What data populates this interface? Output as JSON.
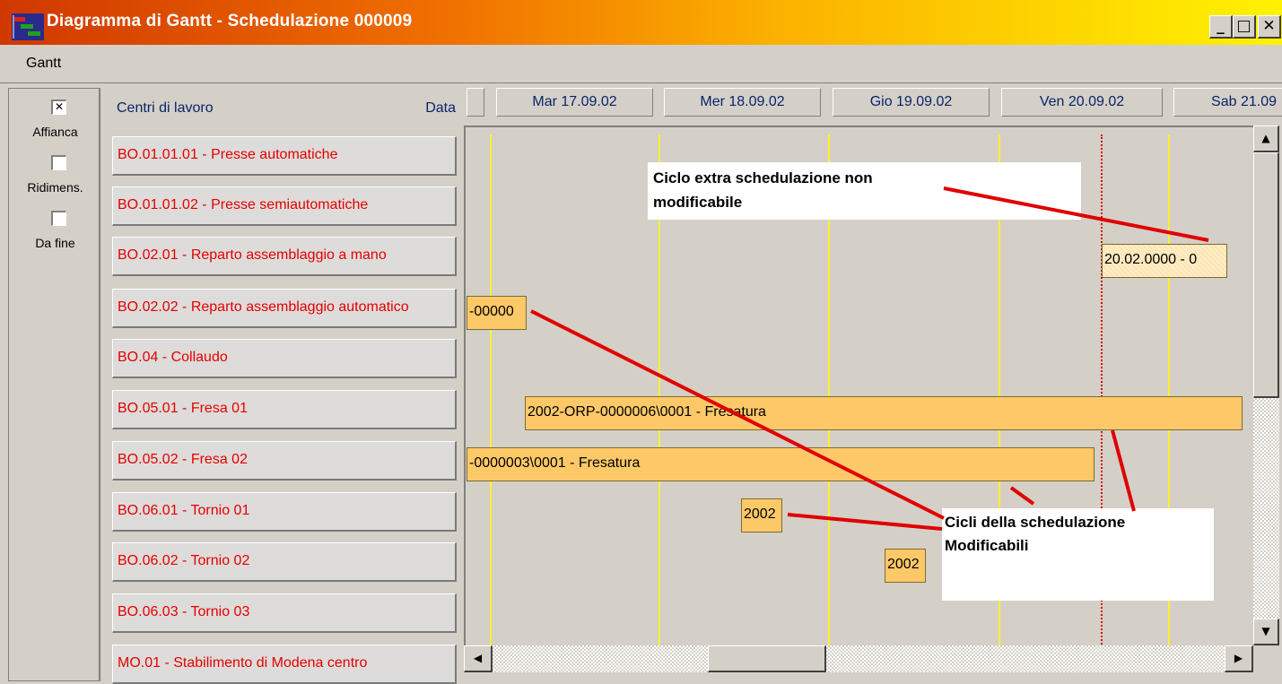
{
  "window": {
    "title": "Diagramma di Gantt  -  Schedulazione 000009",
    "controls": {
      "minimize": "_",
      "maximize": "□",
      "close": "✕"
    }
  },
  "menu": {
    "gantt": "Gantt"
  },
  "options": [
    {
      "label": "Affianca",
      "checked": true
    },
    {
      "label": "Ridimens.",
      "checked": false
    },
    {
      "label": "Da fine",
      "checked": false
    }
  ],
  "header": {
    "centri": "Centri di lavoro",
    "data": "Data"
  },
  "dates": [
    "Mar 17.09.02",
    "Mer 18.09.02",
    "Gio 19.09.02",
    "Ven 20.09.02",
    "Sab 21.09"
  ],
  "work_centers": [
    "BO.01.01.01 - Presse automatiche",
    "BO.01.01.02 - Presse semiautomatiche",
    "BO.02.01 - Reparto assemblaggio a mano",
    "BO.02.02 - Reparto assemblaggio automatico",
    "BO.04 - Collaudo",
    "BO.05.01 - Fresa 01",
    "BO.05.02 - Fresa 02",
    "BO.06.01 - Tornio 01",
    "BO.06.02 - Tornio 02",
    "BO.06.03 - Tornio 03",
    "MO.01 - Stabilimento di Modena centro"
  ],
  "bars": {
    "b1": "20.02.0000 - 0",
    "b2": "-00000",
    "b3": "2002-ORP-0000006\\0001 - Fresatura",
    "b4": "-0000003\\0001 - Fresatura",
    "b5": "2002",
    "b6": "2002"
  },
  "callouts": {
    "extra": "Ciclo extra schedulazione non modificabile",
    "modificabili": "Cicli della schedulazione Modificabili"
  },
  "colors": {
    "accent_text": "#e60000",
    "header_text": "#0a246a",
    "bar_fill": "#fdc968",
    "gridline": "#ffef33",
    "today_line": "#e00000",
    "annotation_arrow": "#e00000"
  },
  "icons": {
    "app": "gantt-chart-icon",
    "scroll_up": "triangle-up",
    "scroll_down": "triangle-down",
    "scroll_left": "triangle-left",
    "scroll_right": "triangle-right"
  }
}
